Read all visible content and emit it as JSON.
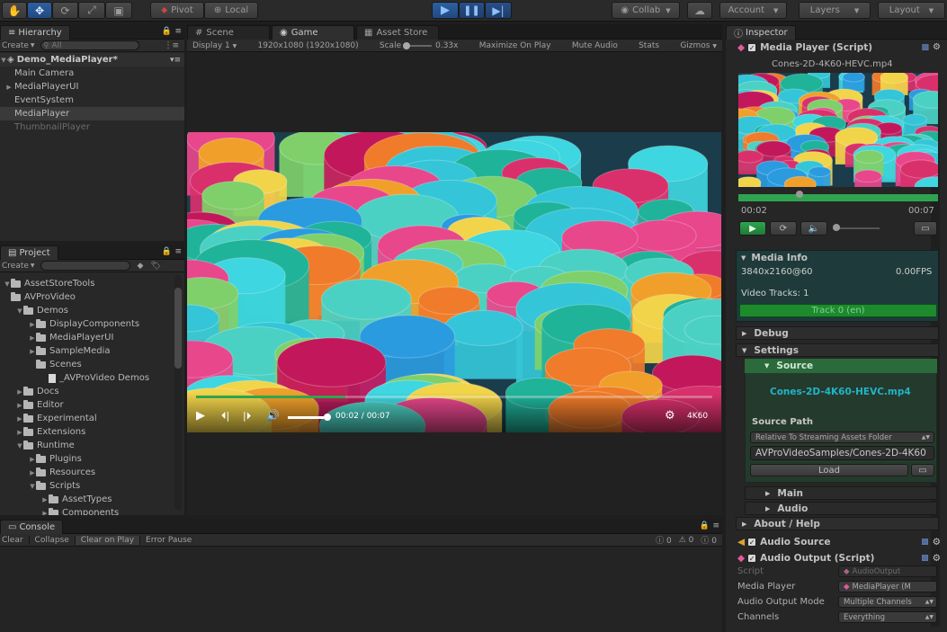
{
  "toolbar": {
    "tool_icons": [
      "hand-icon",
      "move-icon",
      "rotate-icon",
      "scale-icon",
      "rect-icon"
    ],
    "pivot_label": "Pivot",
    "local_label": "Local",
    "collab_label": "Collab",
    "account_label": "Account",
    "layers_label": "Layers",
    "layout_label": "Layout"
  },
  "hierarchy": {
    "tab": "Hierarchy",
    "create": "Create",
    "search_placeholder": "All",
    "scene": "Demo_MediaPlayer*",
    "items": [
      "Main Camera",
      "MediaPlayerUI",
      "EventSystem",
      "MediaPlayer",
      "ThumbnailPlayer"
    ]
  },
  "project": {
    "tab": "Project",
    "create": "Create",
    "items": [
      "AssetStoreTools",
      "AVProVideo",
      "Demos",
      "DisplayComponents",
      "MediaPlayerUI",
      "SampleMedia",
      "Scenes",
      "_AVProVideo Demos",
      "Docs",
      "Editor",
      "Experimental",
      "Extensions",
      "Runtime",
      "Plugins",
      "Resources",
      "Scripts",
      "AssetTypes",
      "Components"
    ]
  },
  "game": {
    "tabs": [
      "Scene",
      "Game",
      "Asset Store"
    ],
    "display": "Display 1",
    "resolution": "1920x1080 (1920x1080)",
    "scale_label": "Scale",
    "scale_value": "0.33x",
    "maximize": "Maximize On Play",
    "mute": "Mute Audio",
    "stats": "Stats",
    "gizmos": "Gizmos",
    "player": {
      "time": "00:02 / 00:07",
      "quality": "4K60",
      "progress": 0.29,
      "volume": 0.9
    }
  },
  "console": {
    "tab": "Console",
    "clear": "Clear",
    "collapse": "Collapse",
    "clear_on_play": "Clear on Play",
    "error_pause": "Error Pause",
    "counts": [
      "0",
      "0",
      "0"
    ]
  },
  "inspector": {
    "tab": "Inspector",
    "component": "Media Player (Script)",
    "filename": "Cones-2D-4K60-HEVC.mp4",
    "time_start": "00:02",
    "time_end": "00:07",
    "media_info": "Media Info",
    "resolution": "3840x2160@60",
    "fps": "0.00FPS",
    "video_tracks": "Video Tracks: 1",
    "track": "Track 0 (en)",
    "debug": "Debug",
    "settings": "Settings",
    "source": "Source",
    "source_file": "Cones-2D-4K60-HEVC.mp4",
    "source_path_label": "Source Path",
    "source_path_mode": "Relative To Streaming Assets Folder",
    "source_path": "AVProVideoSamples/Cones-2D-4K60",
    "load": "Load",
    "main": "Main",
    "audio": "Audio",
    "about": "About / Help",
    "audio_source": "Audio Source",
    "audio_output": "Audio Output (Script)",
    "script_label": "Script",
    "script_value": "AudioOutput",
    "media_player_label": "Media Player",
    "media_player_value": "MediaPlayer (M",
    "output_mode_label": "Audio Output Mode",
    "output_mode_value": "Multiple Channels",
    "channels_label": "Channels",
    "channels_value": "Everything",
    "scrub_progress": 0.29
  },
  "colors": {
    "accent_green": "#2fa44f",
    "track_green": "#1d8a2e",
    "source_teal": "#1fb5c8",
    "play_blue": "#2d5fa0"
  }
}
